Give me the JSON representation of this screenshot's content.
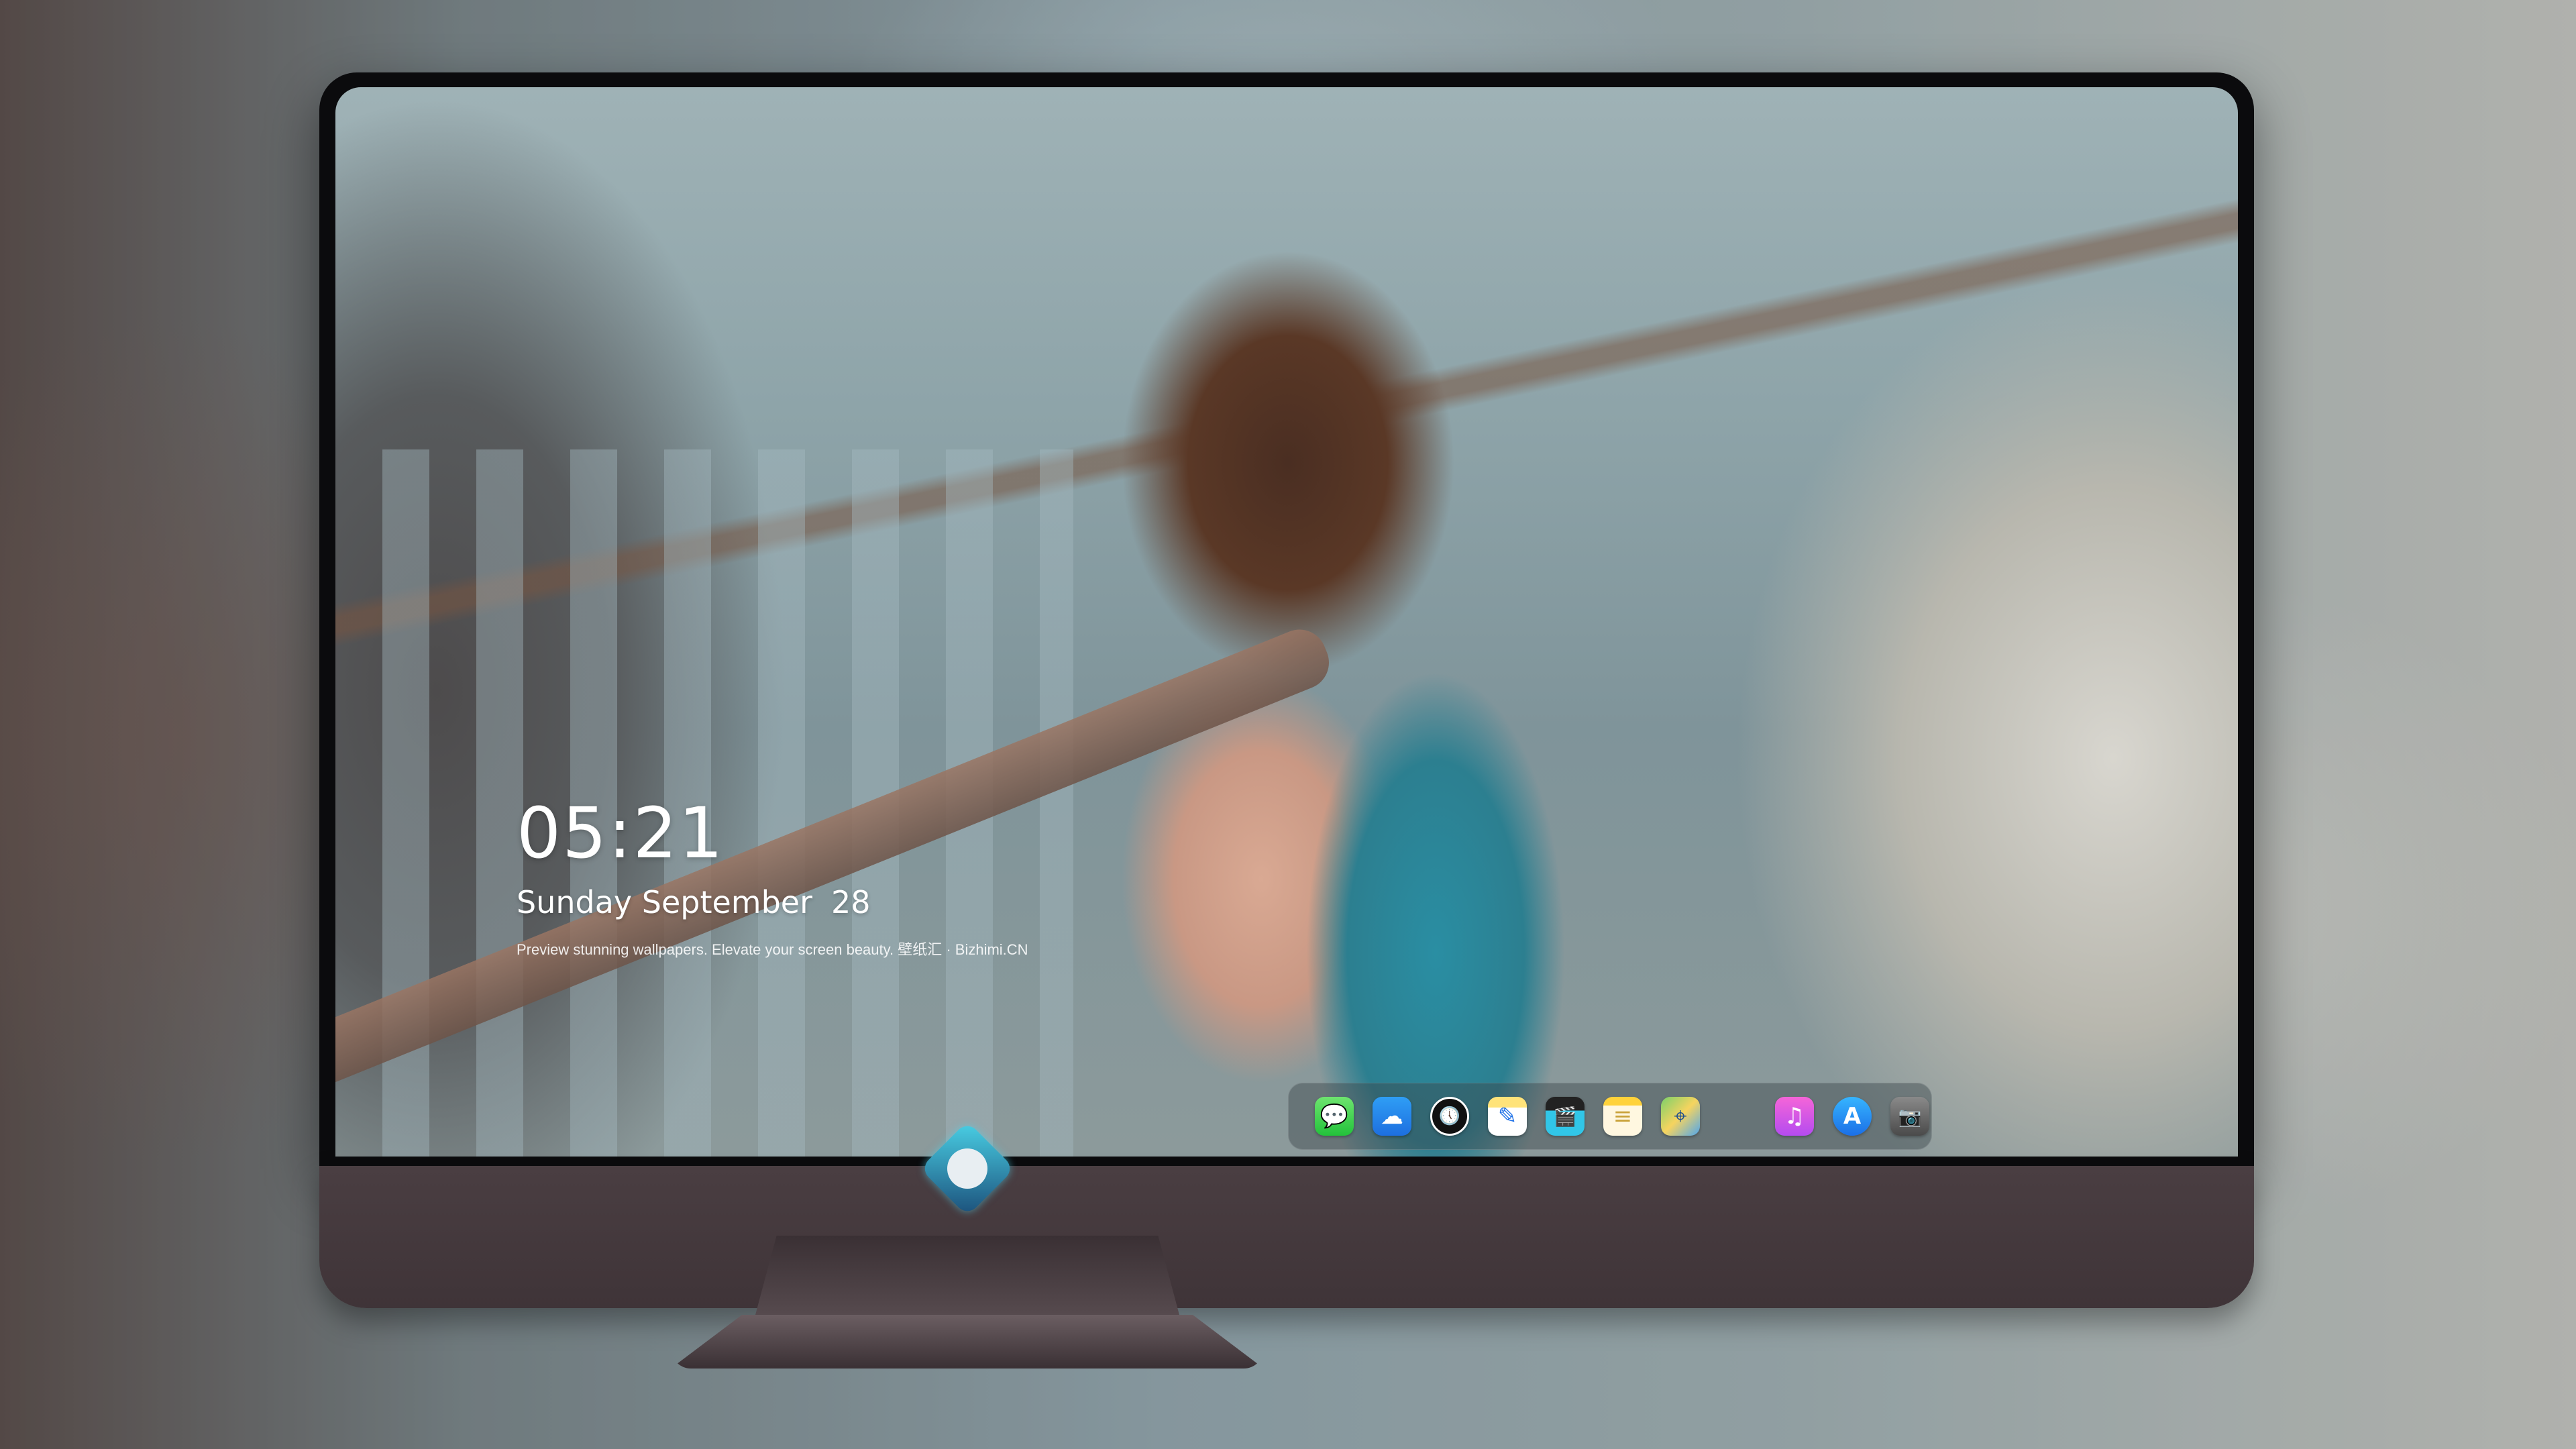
{
  "lockscreen": {
    "time": "05:21",
    "weekday": "Sunday",
    "month": "September",
    "day": "28",
    "tagline": "Preview stunning wallpapers. Elevate your screen beauty. 壁纸汇 · Bizhimi.CN"
  },
  "dock": {
    "items": [
      {
        "name": "messages",
        "glyph": "💬"
      },
      {
        "name": "weather",
        "glyph": "☁"
      },
      {
        "name": "clock",
        "glyph": "🕔"
      },
      {
        "name": "notes",
        "glyph": "✎"
      },
      {
        "name": "video",
        "glyph": "🎬"
      },
      {
        "name": "notes-yellow",
        "glyph": "≡"
      },
      {
        "name": "maps",
        "glyph": "⌖"
      },
      {
        "name": "music",
        "glyph": "♫"
      },
      {
        "name": "app-store",
        "glyph": "A"
      },
      {
        "name": "camera",
        "glyph": "📷"
      }
    ]
  },
  "colors": {
    "monitor_chin": "#4a3e42",
    "bezel": "#0b0b0d",
    "logo_accent": "#4ad1e6"
  }
}
